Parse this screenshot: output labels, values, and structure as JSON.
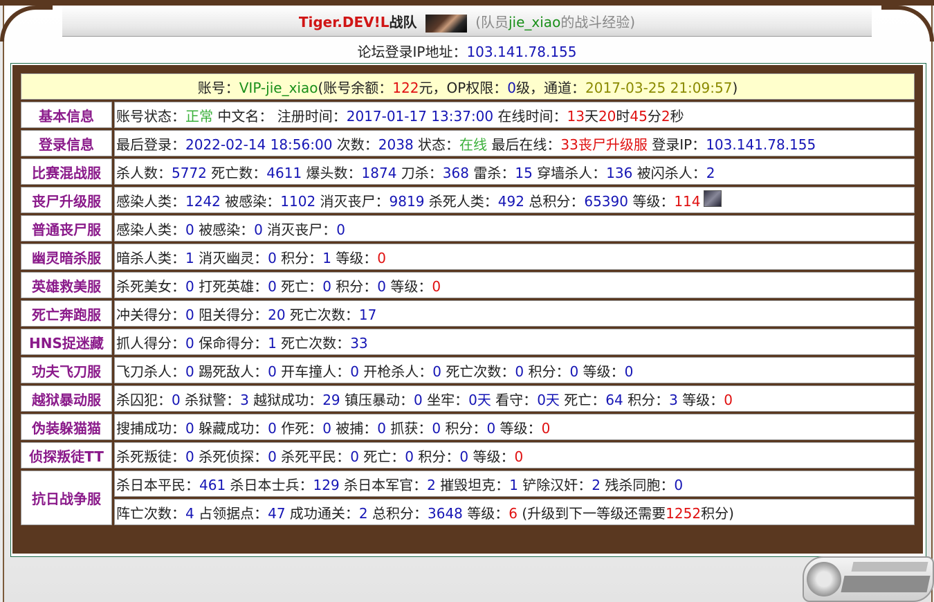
{
  "header": {
    "team_name": "Tiger.DEV!L",
    "team_suffix": "战队",
    "paren_open": "(队员",
    "member": "jie_xiao",
    "paren_close": "的战斗经验)"
  },
  "login_ip": {
    "label": "论坛登录IP地址：",
    "value": "103.141.78.155"
  },
  "account": {
    "label": "账号：",
    "id": "VIP-jie_xiao",
    "balance_label": "(账号余额：",
    "balance": "122",
    "balance_unit": "元，OP权限：",
    "op_level": "0",
    "op_unit": "级，通道：",
    "channel_date": "2017-03-25 21:09:57",
    "close": ")"
  },
  "basic": {
    "label": "基本信息",
    "status_label": "账号状态：",
    "status": "正常",
    "cn_name_label": " 中文名： 注册时间：",
    "reg_time": "2017-01-17 13:37:00",
    "online_label": " 在线时间：",
    "days": "13",
    "days_unit": "天",
    "hours": "20",
    "hours_unit": "时",
    "minutes": "45",
    "minutes_unit": "分",
    "seconds": "2",
    "seconds_unit": "秒"
  },
  "login": {
    "label": "登录信息",
    "last_login_label": "最后登录：",
    "last_login": "2022-02-14 18:56:00",
    "count_label": " 次数：",
    "count": "2038",
    "state_label": " 状态：",
    "state": "在线",
    "last_online_label": " 最后在线：",
    "last_online": "33丧尸升级服",
    "ip_label": " 登录IP：",
    "ip": "103.141.78.155"
  },
  "rows": [
    {
      "label": "比赛混战服",
      "stats": [
        {
          "k": "杀人数：",
          "v": "5772",
          "c": "blue"
        },
        {
          "k": " 死亡数：",
          "v": "4611",
          "c": "blue"
        },
        {
          "k": " 爆头数：",
          "v": "1874",
          "c": "blue"
        },
        {
          "k": " 刀杀：",
          "v": "368",
          "c": "blue"
        },
        {
          "k": " 雷杀：",
          "v": "15",
          "c": "blue"
        },
        {
          "k": " 穿墙杀人：",
          "v": "136",
          "c": "blue"
        },
        {
          "k": " 被闪杀人：",
          "v": "2",
          "c": "blue"
        }
      ]
    },
    {
      "label": "丧尸升级服",
      "avatar": true,
      "stats": [
        {
          "k": "感染人类：",
          "v": "1242",
          "c": "blue"
        },
        {
          "k": " 被感染：",
          "v": "1102",
          "c": "blue"
        },
        {
          "k": " 消灭丧尸：",
          "v": "9819",
          "c": "blue"
        },
        {
          "k": " 杀死人类：",
          "v": "492",
          "c": "blue"
        },
        {
          "k": " 总积分：",
          "v": "65390",
          "c": "blue"
        },
        {
          "k": " 等级：",
          "v": "114",
          "c": "red"
        }
      ]
    },
    {
      "label": "普通丧尸服",
      "stats": [
        {
          "k": "感染人类：",
          "v": "0",
          "c": "blue"
        },
        {
          "k": " 被感染：",
          "v": "0",
          "c": "blue"
        },
        {
          "k": " 消灭丧尸：",
          "v": "0",
          "c": "blue"
        }
      ]
    },
    {
      "label": "幽灵暗杀服",
      "stats": [
        {
          "k": "暗杀人类：",
          "v": "1",
          "c": "blue"
        },
        {
          "k": " 消灭幽灵：",
          "v": "0",
          "c": "blue"
        },
        {
          "k": " 积分：",
          "v": "1",
          "c": "blue"
        },
        {
          "k": " 等级：",
          "v": "0",
          "c": "red"
        }
      ]
    },
    {
      "label": "英雄救美服",
      "stats": [
        {
          "k": "杀死美女：",
          "v": "0",
          "c": "blue"
        },
        {
          "k": " 打死英雄：",
          "v": "0",
          "c": "blue"
        },
        {
          "k": " 死亡：",
          "v": "0",
          "c": "blue"
        },
        {
          "k": " 积分：",
          "v": "0",
          "c": "blue"
        },
        {
          "k": " 等级：",
          "v": "0",
          "c": "red"
        }
      ]
    },
    {
      "label": "死亡奔跑服",
      "stats": [
        {
          "k": "冲关得分：",
          "v": "0",
          "c": "blue"
        },
        {
          "k": " 阻关得分：",
          "v": "20",
          "c": "blue"
        },
        {
          "k": " 死亡次数：",
          "v": "17",
          "c": "blue"
        }
      ]
    },
    {
      "label": "HNS捉迷藏",
      "stats": [
        {
          "k": "抓人得分：",
          "v": "0",
          "c": "blue"
        },
        {
          "k": " 保命得分：",
          "v": "1",
          "c": "blue"
        },
        {
          "k": " 死亡次数：",
          "v": "33",
          "c": "blue"
        }
      ]
    },
    {
      "label": "功夫飞刀服",
      "stats": [
        {
          "k": "飞刀杀人：",
          "v": "0",
          "c": "blue"
        },
        {
          "k": " 踢死敌人：",
          "v": "0",
          "c": "blue"
        },
        {
          "k": " 开车撞人：",
          "v": "0",
          "c": "blue"
        },
        {
          "k": " 开枪杀人：",
          "v": "0",
          "c": "blue"
        },
        {
          "k": " 死亡次数：",
          "v": "0",
          "c": "blue"
        },
        {
          "k": " 积分：",
          "v": "0",
          "c": "blue"
        },
        {
          "k": " 等级：",
          "v": "0",
          "c": "blue"
        }
      ]
    },
    {
      "label": "越狱暴动服",
      "stats": [
        {
          "k": "杀囚犯：",
          "v": "0",
          "c": "blue"
        },
        {
          "k": " 杀狱警：",
          "v": "3",
          "c": "blue"
        },
        {
          "k": " 越狱成功：",
          "v": "29",
          "c": "blue"
        },
        {
          "k": " 镇压暴动：",
          "v": "0",
          "c": "blue"
        },
        {
          "k": " 坐牢：",
          "v": "0天",
          "c": "blue"
        },
        {
          "k": " 看守：",
          "v": "0天",
          "c": "blue"
        },
        {
          "k": " 死亡：",
          "v": "64",
          "c": "blue"
        },
        {
          "k": " 积分：",
          "v": "3",
          "c": "blue"
        },
        {
          "k": " 等级：",
          "v": "0",
          "c": "red"
        }
      ]
    },
    {
      "label": "伪装躲猫猫",
      "stats": [
        {
          "k": "搜捕成功：",
          "v": "0",
          "c": "blue"
        },
        {
          "k": " 躲藏成功：",
          "v": "0",
          "c": "blue"
        },
        {
          "k": " 作死：",
          "v": "0",
          "c": "blue"
        },
        {
          "k": " 被捕：",
          "v": "0",
          "c": "blue"
        },
        {
          "k": " 抓获：",
          "v": "0",
          "c": "blue"
        },
        {
          "k": " 积分：",
          "v": "0",
          "c": "blue"
        },
        {
          "k": " 等级：",
          "v": "0",
          "c": "red"
        }
      ]
    },
    {
      "label": "侦探叛徒TT",
      "stats": [
        {
          "k": "杀死叛徒：",
          "v": "0",
          "c": "blue"
        },
        {
          "k": " 杀死侦探：",
          "v": "0",
          "c": "blue"
        },
        {
          "k": " 杀死平民：",
          "v": "0",
          "c": "blue"
        },
        {
          "k": " 死亡：",
          "v": "0",
          "c": "blue"
        },
        {
          "k": " 积分：",
          "v": "0",
          "c": "blue"
        },
        {
          "k": " 等级：",
          "v": "0",
          "c": "red"
        }
      ]
    }
  ],
  "kangri": {
    "label": "抗日战争服",
    "line1": [
      {
        "k": "杀日本平民：",
        "v": "461",
        "c": "blue"
      },
      {
        "k": " 杀日本士兵：",
        "v": "129",
        "c": "blue"
      },
      {
        "k": " 杀日本军官：",
        "v": "2",
        "c": "blue"
      },
      {
        "k": " 摧毁坦克：",
        "v": "1",
        "c": "blue"
      },
      {
        "k": " 铲除汉奸：",
        "v": "2",
        "c": "blue"
      },
      {
        "k": " 残杀同胞：",
        "v": "0",
        "c": "blue"
      }
    ],
    "line2": [
      {
        "k": "阵亡次数：",
        "v": "4",
        "c": "blue"
      },
      {
        "k": " 占领据点：",
        "v": "47",
        "c": "blue"
      },
      {
        "k": " 成功通关：",
        "v": "2",
        "c": "blue"
      },
      {
        "k": " 总积分：",
        "v": "3648",
        "c": "blue"
      },
      {
        "k": " 等级：",
        "v": "6",
        "c": "red"
      },
      {
        "k": " (升级到下一等级还需要",
        "v": "1252",
        "c": "red"
      },
      {
        "k": "积分)",
        "v": "",
        "c": "blue"
      }
    ]
  },
  "colors": {
    "frame_brown": "#5a3820",
    "label_purple": "#8a1a8a",
    "value_blue": "#1515b5",
    "value_red": "#e01010",
    "account_bg": "#ffffcc"
  }
}
